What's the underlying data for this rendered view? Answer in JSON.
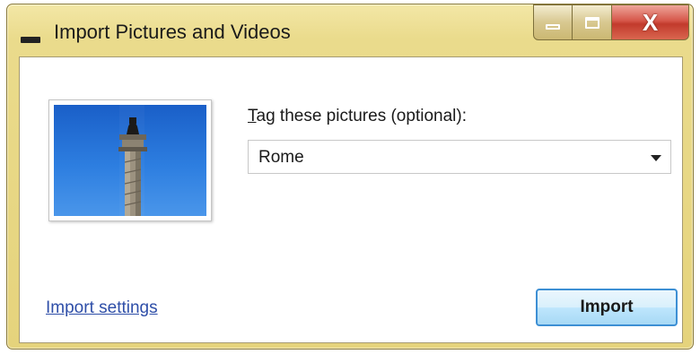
{
  "window": {
    "title": "Import Pictures and Videos",
    "close_glyph": "X"
  },
  "icons": {
    "app": "app-icon",
    "minimize": "minimize-icon",
    "maximize": "maximize-icon",
    "close": "close-icon",
    "dropdown": "chevron-down-icon"
  },
  "form": {
    "tag_label_accel": "T",
    "tag_label_rest": "ag these pictures (optional):",
    "tag_value": "Rome"
  },
  "footer": {
    "settings_link": "Import settings",
    "import_button": "Import"
  },
  "colors": {
    "frame": "#e5d37c",
    "close_button": "#c23a2c",
    "link": "#2e4ea8",
    "button_border": "#3d8fd4",
    "sky": "#2d7ee0"
  }
}
